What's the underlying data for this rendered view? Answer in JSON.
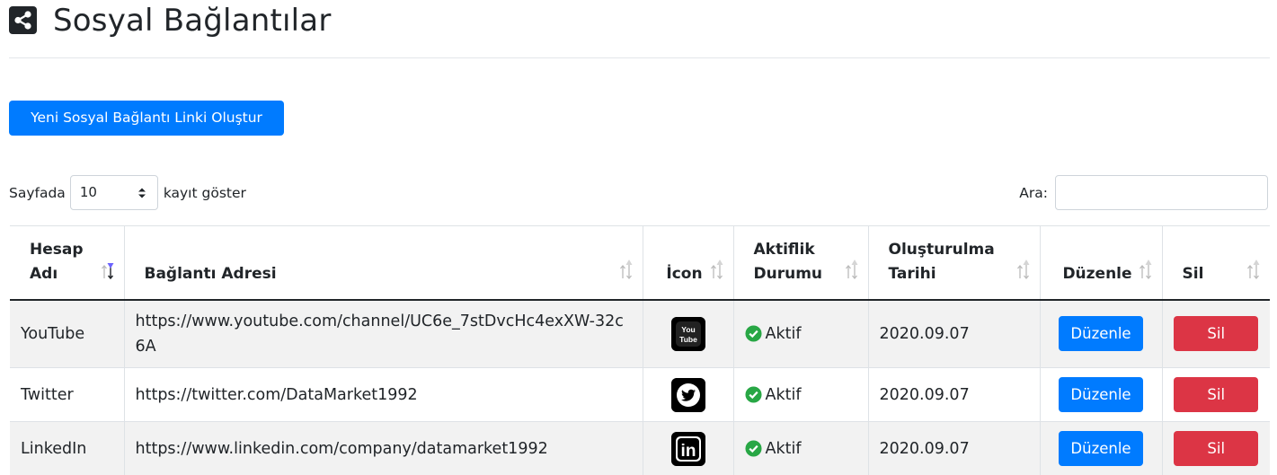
{
  "header": {
    "title": "Sosyal Bağlantılar",
    "icon": "share-square-icon"
  },
  "toolbar": {
    "create_label": "Yeni Sosyal Bağlantı Linki Oluştur"
  },
  "length_control": {
    "prefix": "Sayfada",
    "value": "10",
    "suffix": "kayıt göster"
  },
  "search": {
    "label": "Ara:",
    "value": ""
  },
  "table": {
    "columns": [
      {
        "label": "Hesap Adı",
        "sorted": "ascending"
      },
      {
        "label": "Bağlantı Adresi",
        "sorted": "none"
      },
      {
        "label": "İcon",
        "sorted": "none"
      },
      {
        "label": "Aktiflik Durumu",
        "sorted": "none"
      },
      {
        "label": "Oluşturulma Tarihi",
        "sorted": "none"
      },
      {
        "label": "Düzenle",
        "sorted": "none"
      },
      {
        "label": "Sil",
        "sorted": "none"
      }
    ],
    "rows": [
      {
        "name": "YouTube",
        "url": "https://www.youtube.com/channel/UC6e_7stDvcHc4exXW-32c6A",
        "icon": "youtube-icon",
        "icon_text_top": "You",
        "icon_text_bottom": "Tube",
        "status": "Aktif",
        "date": "2020.09.07",
        "edit_label": "Düzenle",
        "delete_label": "Sil"
      },
      {
        "name": "Twitter",
        "url": "https://twitter.com/DataMarket1992",
        "icon": "twitter-icon",
        "status": "Aktif",
        "date": "2020.09.07",
        "edit_label": "Düzenle",
        "delete_label": "Sil"
      },
      {
        "name": "LinkedIn",
        "url": "https://www.linkedin.com/company/datamarket1992",
        "icon": "linkedin-icon",
        "icon_text": "in",
        "status": "Aktif",
        "date": "2020.09.07",
        "edit_label": "Düzenle",
        "delete_label": "Sil"
      }
    ]
  },
  "colors": {
    "primary": "#007bff",
    "danger": "#dc3545",
    "success": "#28a745",
    "text": "#212529",
    "stripe": "#f2f2f2"
  }
}
